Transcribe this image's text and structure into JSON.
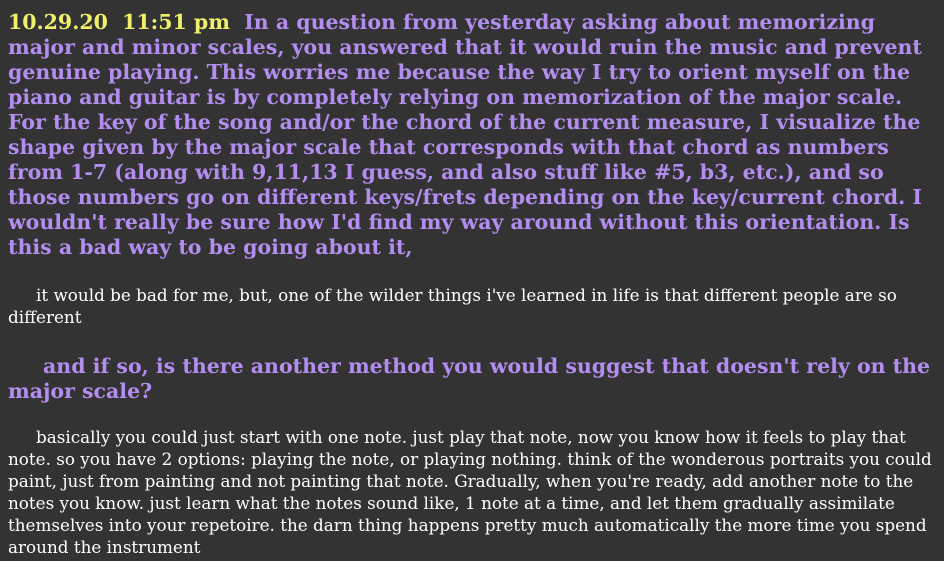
{
  "post": {
    "timestamp": "10.29.20  11:51 pm  ",
    "question_1": "In a question from yesterday asking about memorizing major and minor scales, you answered that it would ruin the music and prevent genuine playing. This worries me because the way I try to orient myself on the piano and guitar is by completely relying on memorization of the major scale. For the key of the song and/or the chord of the current measure, I visualize the shape given by the major scale that corresponds with that chord as numbers from 1-7 (along with 9,11,13 I guess, and also stuff like #5, b3, etc.), and so those numbers go on different keys/frets depending on the key/current chord. I wouldn't really be sure how I'd find my way around without this orientation. Is this a bad way to be going about it,",
    "answer_1": "it would be bad for me, but, one of the wilder things i've learned in life is that different people are so different",
    "question_2": "and if so, is there another method you would suggest that doesn't rely on the major scale?",
    "answer_2": "basically you could just start with one note. just play that note, now you know how it feels to play that note. so you have 2 options: playing the note, or playing nothing. think of the wonderous portraits you could paint, just from painting and not painting that note. Gradually, when you're ready, add another note to the notes you know. just learn what the notes sound like, 1 note at a time, and let them gradually assimilate themselves into your repetoire. the darn thing happens pretty much automatically the more time you spend around the instrument"
  },
  "colors": {
    "background": "#333333",
    "timestamp": "#f0f06a",
    "question": "#b38ef0",
    "answer": "#ffffff"
  }
}
